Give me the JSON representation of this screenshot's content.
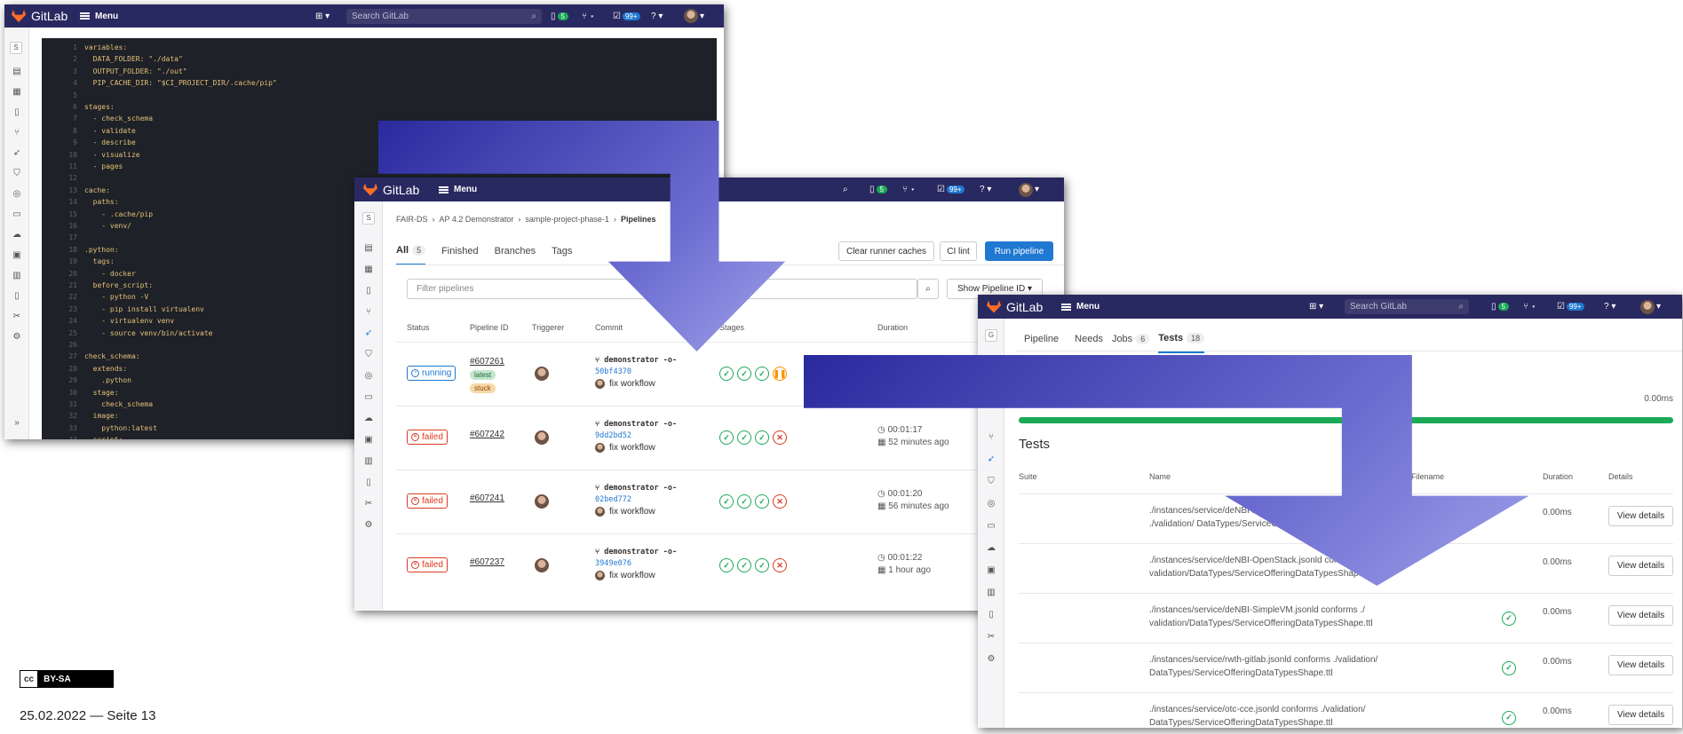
{
  "app": {
    "name": "GitLab",
    "menu": "Menu",
    "search_placeholder": "Search GitLab"
  },
  "topbar": {
    "todo_count": "5",
    "mr_count": "99+",
    "issues_count": "5"
  },
  "editor": {
    "sidebar_initial": "S",
    "lines": [
      {
        "n": "1",
        "t": "variables:"
      },
      {
        "n": "2",
        "t": "  DATA_FOLDER: \"./data\""
      },
      {
        "n": "3",
        "t": "  OUTPUT_FOLDER: \"./out\""
      },
      {
        "n": "4",
        "t": "  PIP_CACHE_DIR: \"$CI_PROJECT_DIR/.cache/pip\""
      },
      {
        "n": "5",
        "t": ""
      },
      {
        "n": "6",
        "t": "stages:"
      },
      {
        "n": "7",
        "t": "  - check_schema"
      },
      {
        "n": "8",
        "t": "  - validate"
      },
      {
        "n": "9",
        "t": "  - describe"
      },
      {
        "n": "10",
        "t": "  - visualize"
      },
      {
        "n": "11",
        "t": "  - pages"
      },
      {
        "n": "12",
        "t": ""
      },
      {
        "n": "13",
        "t": "cache:"
      },
      {
        "n": "14",
        "t": "  paths:"
      },
      {
        "n": "15",
        "t": "    - .cache/pip"
      },
      {
        "n": "16",
        "t": "    - venv/"
      },
      {
        "n": "17",
        "t": ""
      },
      {
        "n": "18",
        "t": ".python:"
      },
      {
        "n": "19",
        "t": "  tags:"
      },
      {
        "n": "20",
        "t": "    - docker"
      },
      {
        "n": "21",
        "t": "  before_script:"
      },
      {
        "n": "22",
        "t": "    - python -V"
      },
      {
        "n": "23",
        "t": "    - pip install virtualenv"
      },
      {
        "n": "24",
        "t": "    - virtualenv venv"
      },
      {
        "n": "25",
        "t": "    - source venv/bin/activate"
      },
      {
        "n": "26",
        "t": ""
      },
      {
        "n": "27",
        "t": "check_schema:"
      },
      {
        "n": "28",
        "t": "  extends:"
      },
      {
        "n": "29",
        "t": "    .python"
      },
      {
        "n": "30",
        "t": "  stage:"
      },
      {
        "n": "31",
        "t": "    check_schema"
      },
      {
        "n": "32",
        "t": "  image:"
      },
      {
        "n": "33",
        "t": "    python:latest"
      },
      {
        "n": "34",
        "t": "  script:"
      }
    ]
  },
  "pipelines": {
    "sidebar_initial": "S",
    "breadcrumb": [
      "FAIR-DS",
      "AP 4.2 Demonstrator",
      "sample-project-phase-1",
      "Pipelines"
    ],
    "tabs": [
      {
        "label": "All",
        "count": "5"
      },
      {
        "label": "Finished"
      },
      {
        "label": "Branches"
      },
      {
        "label": "Tags"
      }
    ],
    "buttons": {
      "clear": "Clear runner caches",
      "lint": "CI lint",
      "run": "Run pipeline",
      "show": "Show Pipeline ID"
    },
    "filter_placeholder": "Filter pipelines",
    "columns": [
      "Status",
      "Pipeline ID",
      "Triggerer",
      "Commit",
      "Stages",
      "Duration"
    ],
    "rows": [
      {
        "status": "running",
        "id": "#607261",
        "tags": [
          "latest",
          "stuck"
        ],
        "branch": "demonstrator",
        "sha": "50bf4370",
        "msg": "fix workflow",
        "stages": [
          "ok",
          "ok",
          "ok",
          "pa"
        ],
        "time": "",
        "ago": ""
      },
      {
        "status": "failed",
        "id": "#607242",
        "tags": [],
        "branch": "demonstrator",
        "sha": "9dd2bd52",
        "msg": "fix workflow",
        "stages": [
          "ok",
          "ok",
          "ok",
          "x"
        ],
        "time": "00:01:17",
        "ago": "52 minutes ago"
      },
      {
        "status": "failed",
        "id": "#607241",
        "tags": [],
        "branch": "demonstrator",
        "sha": "02bed772",
        "msg": "fix workflow",
        "stages": [
          "ok",
          "ok",
          "ok",
          "x"
        ],
        "time": "00:01:20",
        "ago": "56 minutes ago"
      },
      {
        "status": "failed",
        "id": "#607237",
        "tags": [],
        "branch": "demonstrator",
        "sha": "3949e076",
        "msg": "fix workflow",
        "stages": [
          "ok",
          "ok",
          "ok",
          "x"
        ],
        "time": "00:01:22",
        "ago": "1 hour ago"
      }
    ]
  },
  "tests": {
    "sidebar_initial": "G",
    "tabs": [
      {
        "label": "Pipeline"
      },
      {
        "label": "Needs"
      },
      {
        "label": "Jobs",
        "count": "6"
      },
      {
        "label": "Tests",
        "count": "18"
      }
    ],
    "duration_total": "0.00ms",
    "heading": "Tests",
    "columns": [
      "Suite",
      "Name",
      "Filename",
      "Duration",
      "Details"
    ],
    "rows": [
      {
        "name": "./instances/service/deNBI-ACEseq.jsonld conforms ./validation/ DataTypes/ServiceOfferingDataTypesShape.ttl",
        "duration": "0.00ms",
        "ok": false
      },
      {
        "name": "./instances/service/deNBI-OpenStack.jsonld conforms ./ validation/DataTypes/ServiceOfferingDataTypesShape.ttl",
        "duration": "0.00ms",
        "ok": false
      },
      {
        "name": "./instances/service/deNBI-SimpleVM.jsonld conforms ./ validation/DataTypes/ServiceOfferingDataTypesShape.ttl",
        "duration": "0.00ms",
        "ok": true
      },
      {
        "name": "./instances/service/rwth-gitlab.jsonld conforms ./validation/ DataTypes/ServiceOfferingDataTypesShape.ttl",
        "duration": "0.00ms",
        "ok": true
      },
      {
        "name": "./instances/service/otc-cce.jsonld conforms ./validation/ DataTypes/ServiceOfferingDataTypesShape.ttl",
        "duration": "0.00ms",
        "ok": true
      }
    ],
    "view_details": "View details"
  },
  "footer": {
    "license": "BY-SA",
    "cc": "cc",
    "date_page": "25.02.2022  —  Seite 13"
  }
}
